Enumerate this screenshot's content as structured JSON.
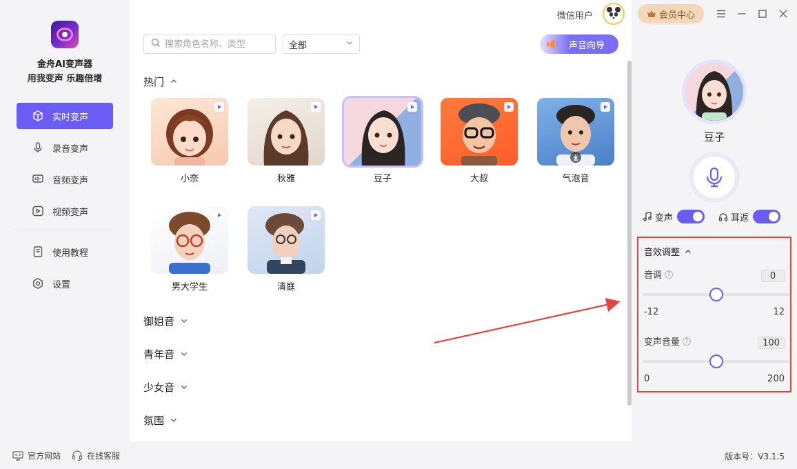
{
  "app": {
    "name": "金舟AI变声器",
    "slogan": "用我变声 乐趣倍增"
  },
  "nav": [
    {
      "label": "实时变声",
      "icon": "cube-icon",
      "active": true
    },
    {
      "label": "录音变声",
      "icon": "microphone-icon",
      "active": false
    },
    {
      "label": "音频变声",
      "icon": "audio-wave-icon",
      "active": false
    },
    {
      "label": "视频变声",
      "icon": "video-play-icon",
      "active": false
    },
    {
      "label": "使用教程",
      "icon": "book-icon",
      "active": false
    },
    {
      "label": "设置",
      "icon": "settings-icon",
      "active": false
    }
  ],
  "topbar": {
    "user_name": "微信用户",
    "vip_label": "会员中心"
  },
  "search": {
    "placeholder": "搜索角色名称、类型"
  },
  "filter": {
    "selected": "全部"
  },
  "guide_button": "声音向导",
  "categories": {
    "hot": "热门",
    "yujie": "御姐音",
    "qingnian": "青年音",
    "shaonv": "少女音",
    "fenwei": "氛围"
  },
  "voices": [
    {
      "name": "小奈"
    },
    {
      "name": "秋雅"
    },
    {
      "name": "豆子",
      "selected": true
    },
    {
      "name": "大叔"
    },
    {
      "name": "气泡音"
    },
    {
      "name": "男大学生"
    },
    {
      "name": "清庭"
    }
  ],
  "panel": {
    "selected_voice": "豆子",
    "toggle_voice_label": "变声",
    "toggle_monitor_label": "耳返",
    "toggle_voice_on": true,
    "toggle_monitor_on": true,
    "fx_title": "音效调整",
    "pitch_label": "音调",
    "pitch_value": "0",
    "pitch_min": "-12",
    "pitch_max": "12",
    "volume_label": "变声音量",
    "volume_value": "100",
    "volume_min": "0",
    "volume_max": "200",
    "help_glyph": "?"
  },
  "footer": {
    "website": "官方网站",
    "support": "在线客服",
    "version": "版本号：V3.1.5"
  },
  "colors": {
    "accent": "#6b5cf5",
    "highlight_box": "#e2463d",
    "vip": "#f4d6b8"
  }
}
